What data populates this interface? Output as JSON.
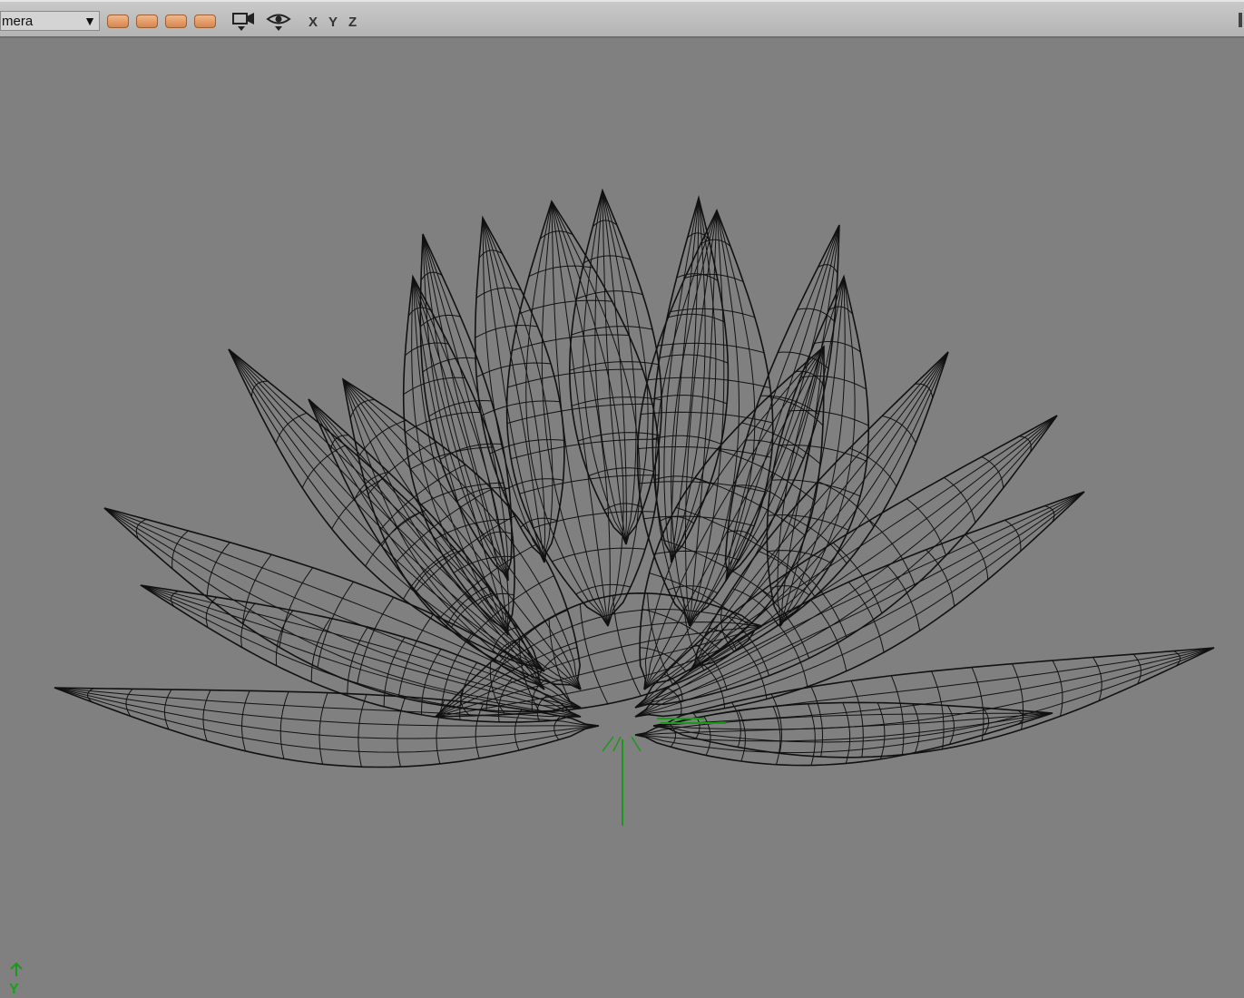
{
  "toolbar": {
    "camera_label": "mera",
    "axis_labels": [
      "X",
      "Y",
      "Z"
    ],
    "swatch_color": "#e69a66",
    "icons": [
      "camera-icon",
      "eye-icon"
    ]
  },
  "viewport": {
    "background": "#808080",
    "mesh_color": "#111111",
    "pivot_color": "#1a9a1a",
    "axis_indicator": "Y"
  }
}
